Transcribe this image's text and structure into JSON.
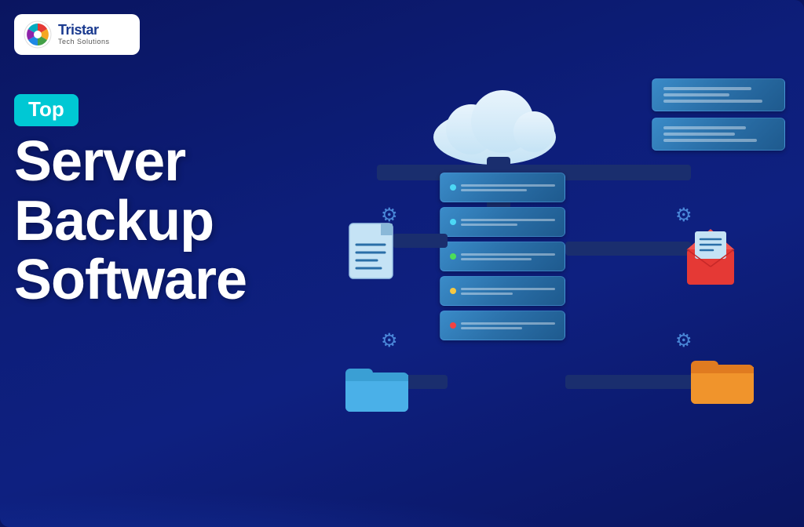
{
  "logo": {
    "name": "Tristar",
    "subtitle": "Tech Solutions"
  },
  "badge": {
    "label": "Top"
  },
  "title": {
    "line1": "Server",
    "line2": "Backup",
    "line3": "Software"
  },
  "colors": {
    "background": "#0a1560",
    "badge_bg": "#00c8d4",
    "server_blue": "#2a6fa8",
    "trunk_dark": "#1a2e6e",
    "cloud_light": "#d0eaf8",
    "dot_green": "#4cdd5a",
    "dot_yellow": "#f5c842",
    "dot_red": "#f54242",
    "dot_cyan": "#4cd8f5"
  },
  "illustration": {
    "elements": [
      "cloud",
      "server-stack",
      "nas-units",
      "document-left",
      "folder-left",
      "email-right",
      "folder-right"
    ]
  }
}
